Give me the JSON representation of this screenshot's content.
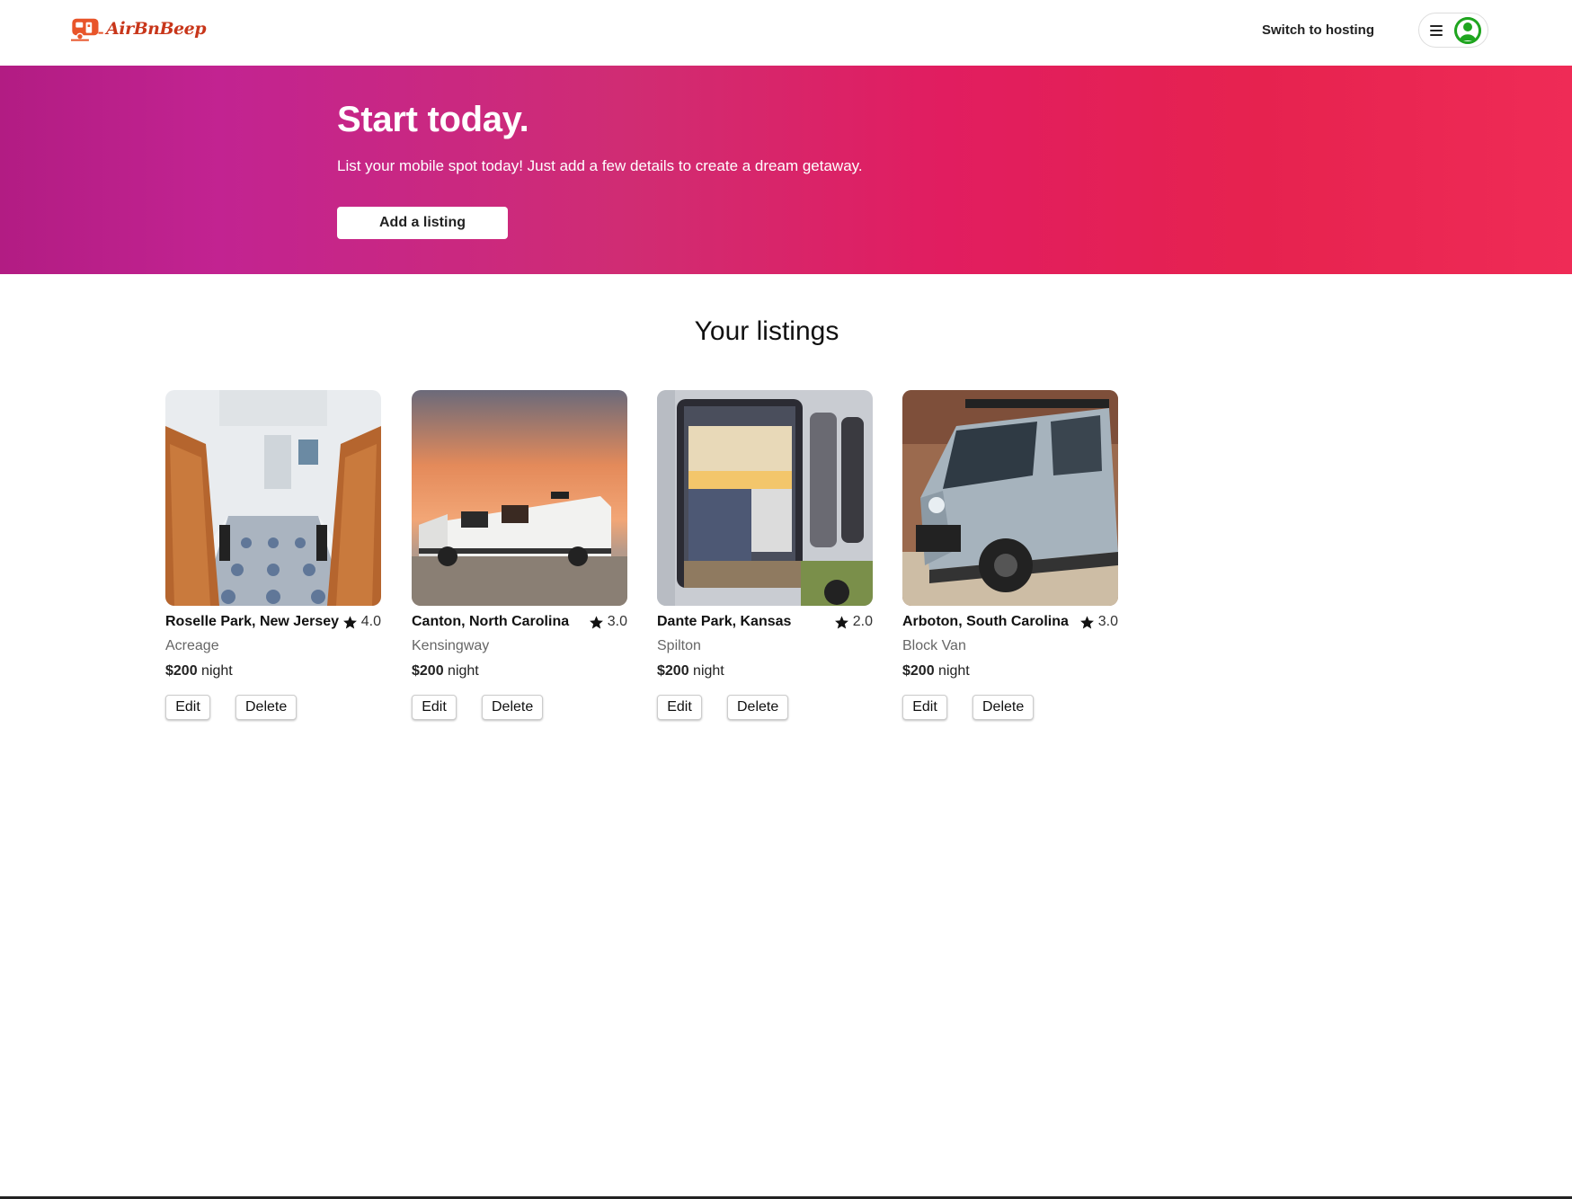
{
  "header": {
    "logo_text": "AirBnBeep",
    "switch_label": "Switch to hosting",
    "menu_icon": "hamburger-icon",
    "avatar_icon": "user-avatar-icon"
  },
  "hero": {
    "title": "Start today.",
    "subtitle": "List your mobile spot today! Just add a few details to create a dream getaway.",
    "button_label": "Add a listing"
  },
  "listings_section": {
    "title": "Your listings"
  },
  "listings": [
    {
      "location": "Roselle Park, New Jersey",
      "rating": "4.0",
      "name": "Acreage",
      "price": "$200",
      "unit": " night",
      "edit": "Edit",
      "delete": "Delete"
    },
    {
      "location": "Canton, North Carolina",
      "rating": "3.0",
      "name": "Kensingway",
      "price": "$200",
      "unit": " night",
      "edit": "Edit",
      "delete": "Delete"
    },
    {
      "location": "Dante Park, Kansas",
      "rating": "2.0",
      "name": "Spilton",
      "price": "$200",
      "unit": " night",
      "edit": "Edit",
      "delete": "Delete"
    },
    {
      "location": "Arboton, South Carolina",
      "rating": "3.0",
      "name": "Block Van",
      "price": "$200",
      "unit": " night",
      "edit": "Edit",
      "delete": "Delete"
    }
  ],
  "colors": {
    "brand": "#c8361a",
    "hero_start": "#b21c83",
    "hero_end": "#ef2b56",
    "avatar": "#1fa51f"
  }
}
